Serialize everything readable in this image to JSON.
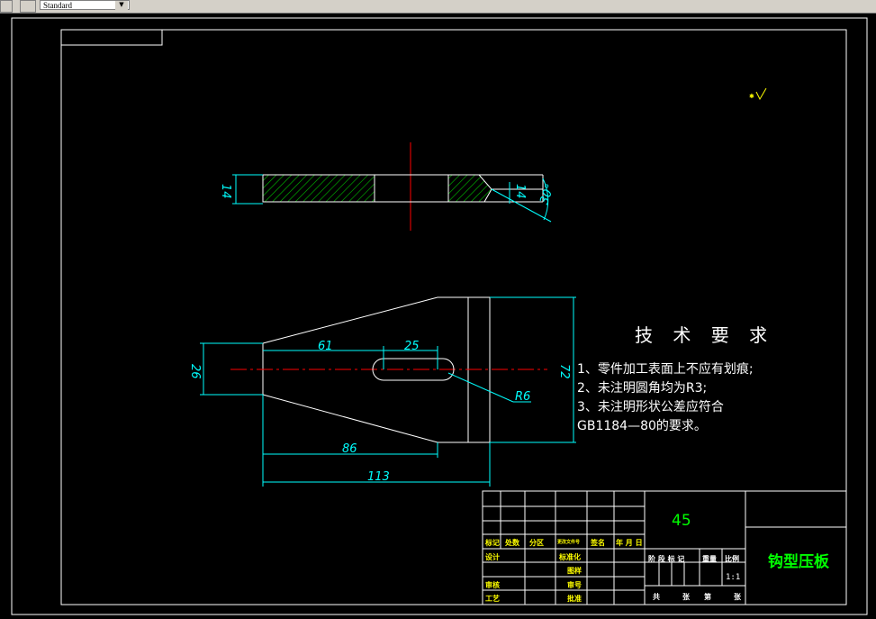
{
  "toolbar": {
    "style_combo": "Standard",
    "combo_arrow": "▼"
  },
  "dimensions": {
    "d61": "61",
    "d25": "25",
    "d26": "26",
    "d72": "72",
    "d86": "86",
    "d113": "113",
    "r6": "R6",
    "d14a": "14",
    "d14b": "14",
    "ang30": "30°"
  },
  "tech": {
    "title": "技 术 要 求",
    "line1": "1、零件加工表面上不应有划痕;",
    "line2": "2、未注明圆角均为R3;",
    "line3": "3、未注明形状公差应符合",
    "line4": "GB1184—80的要求。"
  },
  "titleblock": {
    "material": "45",
    "part_name": "钩型压板",
    "scale_value": "1:1",
    "marker": "标记",
    "count": "处数",
    "zone": "分区",
    "doc_no": "更改文件号",
    "sign": "签名",
    "date": "年 月 日",
    "design": "设计",
    "standard": "标准化",
    "check": "审核",
    "process": "工艺",
    "pattern": "图样",
    "approve": "批准",
    "stage": "阶 段 标 记",
    "weight": "重量",
    "ratio": "比例",
    "total": "共",
    "sheets": "张",
    "nth": "第",
    "sheet": "张",
    "record": "审号"
  },
  "colors": {
    "dim": "#00ffff",
    "center": "#ff0000",
    "hatch": "#00ff00",
    "label": "#ffff00",
    "name": "#00ff00"
  }
}
